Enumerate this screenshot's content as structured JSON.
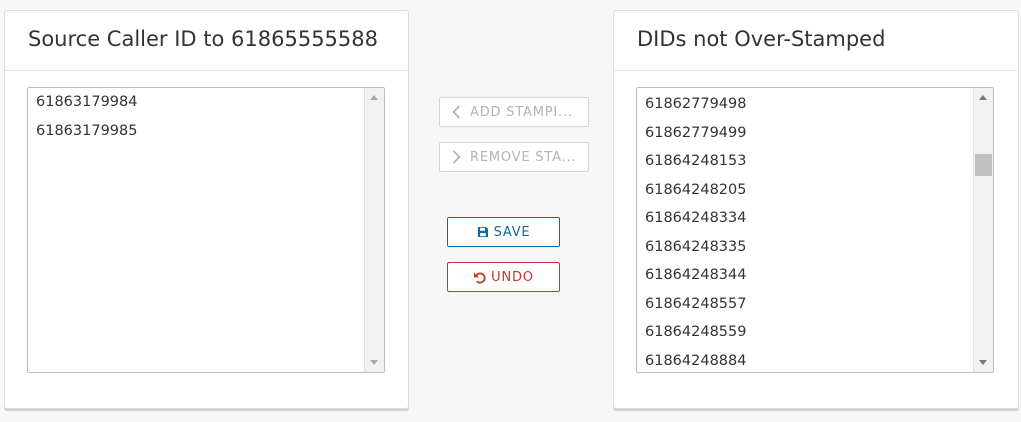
{
  "left_panel": {
    "title": "Source Caller ID to 61865555588",
    "items": [
      "61863179984",
      "61863179985"
    ]
  },
  "right_panel": {
    "title": "DIDs not Over-Stamped",
    "items": [
      "61862779498",
      "61862779499",
      "61864248153",
      "61864248205",
      "61864248334",
      "61864248335",
      "61864248344",
      "61864248557",
      "61864248559",
      "61864248884"
    ]
  },
  "buttons": {
    "add_label": "ADD STAMPI...",
    "remove_label": "REMOVE STA...",
    "save_label": "SAVE",
    "undo_label": "UNDO"
  },
  "colors": {
    "save": "#0b6aa2",
    "undo": "#c0392b",
    "disabled": "#b3b3b3"
  },
  "icons": {
    "add": "chevron-left-icon",
    "remove": "chevron-right-icon",
    "save": "floppy-disk-icon",
    "undo": "undo-arrow-icon"
  }
}
